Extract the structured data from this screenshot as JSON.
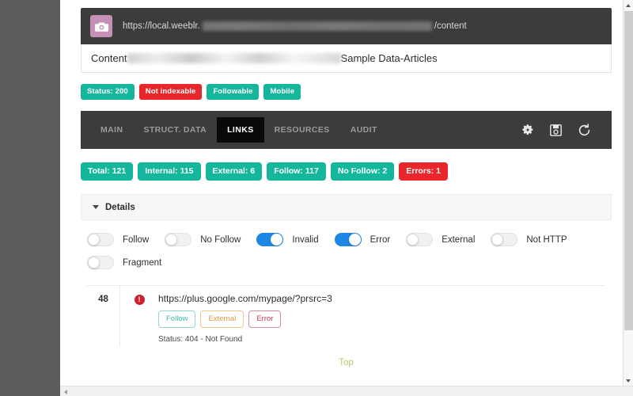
{
  "url_bar": {
    "icon": "camera-icon",
    "prefix": "https://local.weeblr.",
    "suffix": "/content",
    "redacted": true
  },
  "content_row": {
    "label": "Content",
    "value": "Sample Data-Articles"
  },
  "flags": [
    {
      "label": "Status: 200",
      "style": "teal"
    },
    {
      "label": "Not indexable",
      "style": "red"
    },
    {
      "label": "Followable",
      "style": "teal"
    },
    {
      "label": "Mobile",
      "style": "teal"
    }
  ],
  "tabs": [
    {
      "label": "MAIN",
      "active": false
    },
    {
      "label": "STRUCT. DATA",
      "active": false
    },
    {
      "label": "LINKS",
      "active": true
    },
    {
      "label": "RESOURCES",
      "active": false
    },
    {
      "label": "AUDIT",
      "active": false
    }
  ],
  "tool_icons": [
    {
      "name": "gear-icon"
    },
    {
      "name": "save-icon"
    },
    {
      "name": "refresh-icon"
    }
  ],
  "counters": [
    {
      "label": "Total: 121",
      "style": "teal"
    },
    {
      "label": "Internal: 115",
      "style": "teal"
    },
    {
      "label": "External: 6",
      "style": "teal"
    },
    {
      "label": "Follow: 117",
      "style": "teal"
    },
    {
      "label": "No Follow: 2",
      "style": "teal"
    },
    {
      "label": "Errors: 1",
      "style": "red"
    }
  ],
  "details": {
    "title": "Details",
    "expanded": true,
    "filters_row1": [
      {
        "label": "Follow",
        "on": false
      },
      {
        "label": "No Follow",
        "on": false
      },
      {
        "label": "Invalid",
        "on": true
      },
      {
        "label": "Error",
        "on": true
      },
      {
        "label": "External",
        "on": false
      },
      {
        "label": "Not HTTP",
        "on": false
      }
    ],
    "filters_row2": [
      {
        "label": "Fragment",
        "on": false
      }
    ]
  },
  "results": [
    {
      "number": "48",
      "icon": "error-circle-icon",
      "url": "https://plus.google.com/mypage/?prsrc=3",
      "badges": [
        {
          "label": "Follow",
          "style": "follow"
        },
        {
          "label": "External",
          "style": "external"
        },
        {
          "label": "Error",
          "style": "error"
        }
      ],
      "status": "Status: 404 - Not Found"
    }
  ],
  "footer": {
    "top_link": "Top"
  },
  "colors": {
    "teal": "#14b79b",
    "red": "#e8262b",
    "toggle_on": "#1e87e5",
    "dark_bar": "#3c3c3b",
    "active_tab": "#0a0a0a",
    "backdrop": "#5c5c5c",
    "top_link": "#b7c96a",
    "site_icon": "#c490b6"
  }
}
